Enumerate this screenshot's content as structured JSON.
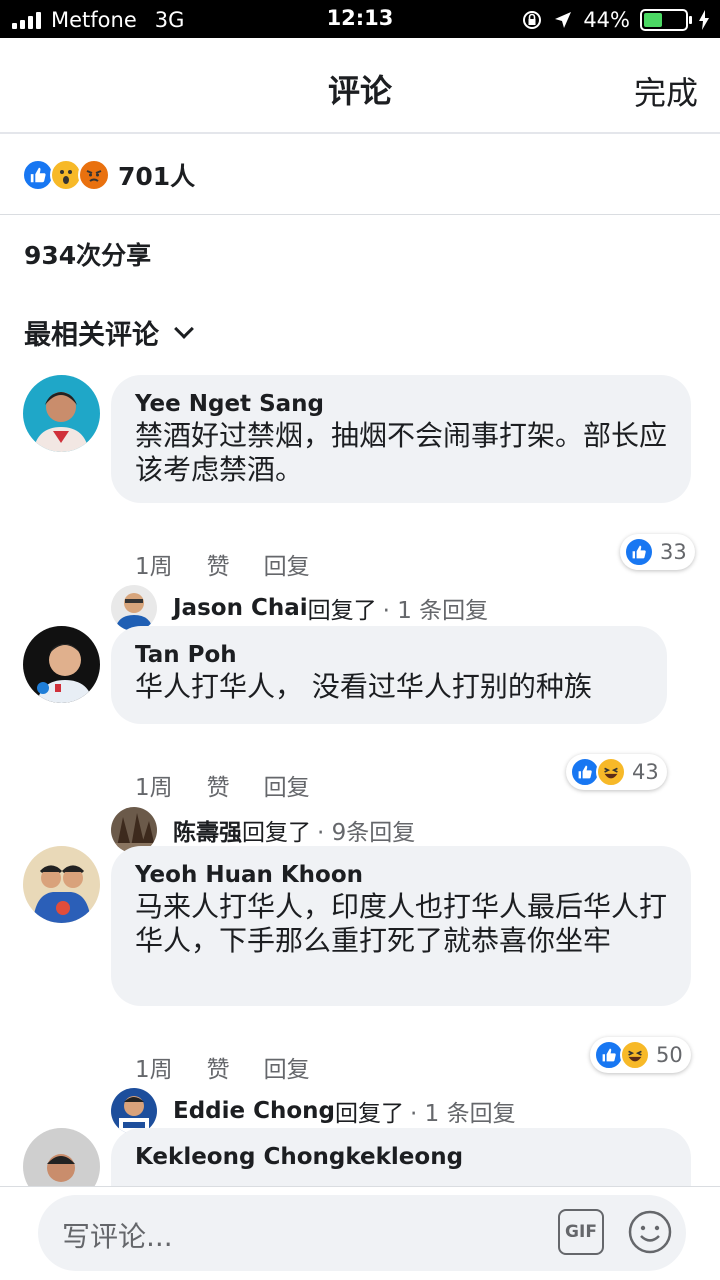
{
  "status": {
    "carrier": "Metfone",
    "network": "3G",
    "time": "12:13",
    "battery": "44%",
    "battery_level": 0.44,
    "battery_color": "#4cd964"
  },
  "header": {
    "title": "评论",
    "done_label": "完成"
  },
  "summary": {
    "reaction_icons": [
      "like-icon",
      "wow-icon",
      "angry-icon"
    ],
    "reactions_count": "701人",
    "shares": "934次分享",
    "sort_label": "最相关评论"
  },
  "comments": [
    {
      "author": "Yee Nget Sang",
      "text": "禁酒好过禁烟，抽烟不会闹事打架。部长应该考虑禁酒。",
      "time": "1周",
      "like_label": "赞",
      "reply_label": "回复",
      "reaction_icons": [
        "like-icon"
      ],
      "reaction_count": "33",
      "reply_author": "Jason Chai",
      "reply_suffix": "回复了",
      "reply_count": "· 1 条回复"
    },
    {
      "author": "Tan Poh",
      "text": "华人打华人， 没看过华人打别的种族",
      "time": "1周",
      "like_label": "赞",
      "reply_label": "回复",
      "reaction_icons": [
        "like-icon",
        "haha-icon"
      ],
      "reaction_count": "43",
      "reply_author": "陈壽强",
      "reply_suffix": "回复了",
      "reply_count": "· 9条回复"
    },
    {
      "author": "Yeoh Huan Khoon",
      "text": "马来人打华人，印度人也打华人最后华人打华人，下手那么重打死了就恭喜你坐牢",
      "time": "1周",
      "like_label": "赞",
      "reply_label": "回复",
      "reaction_icons": [
        "like-icon",
        "haha-icon"
      ],
      "reaction_count": "50",
      "reply_author": "Eddie Chong",
      "reply_suffix": "回复了",
      "reply_count": "· 1 条回复"
    },
    {
      "author": "Kekleong Chongkekleong"
    }
  ],
  "composer": {
    "placeholder": "写评论...",
    "gif_label": "GIF"
  },
  "colors": {
    "like_blue": "#1877f2",
    "haha_yellow": "#f7b928",
    "angry_orange": "#e9710f",
    "bubble_bg": "#f0f2f5",
    "meta_gray": "#65676b"
  }
}
